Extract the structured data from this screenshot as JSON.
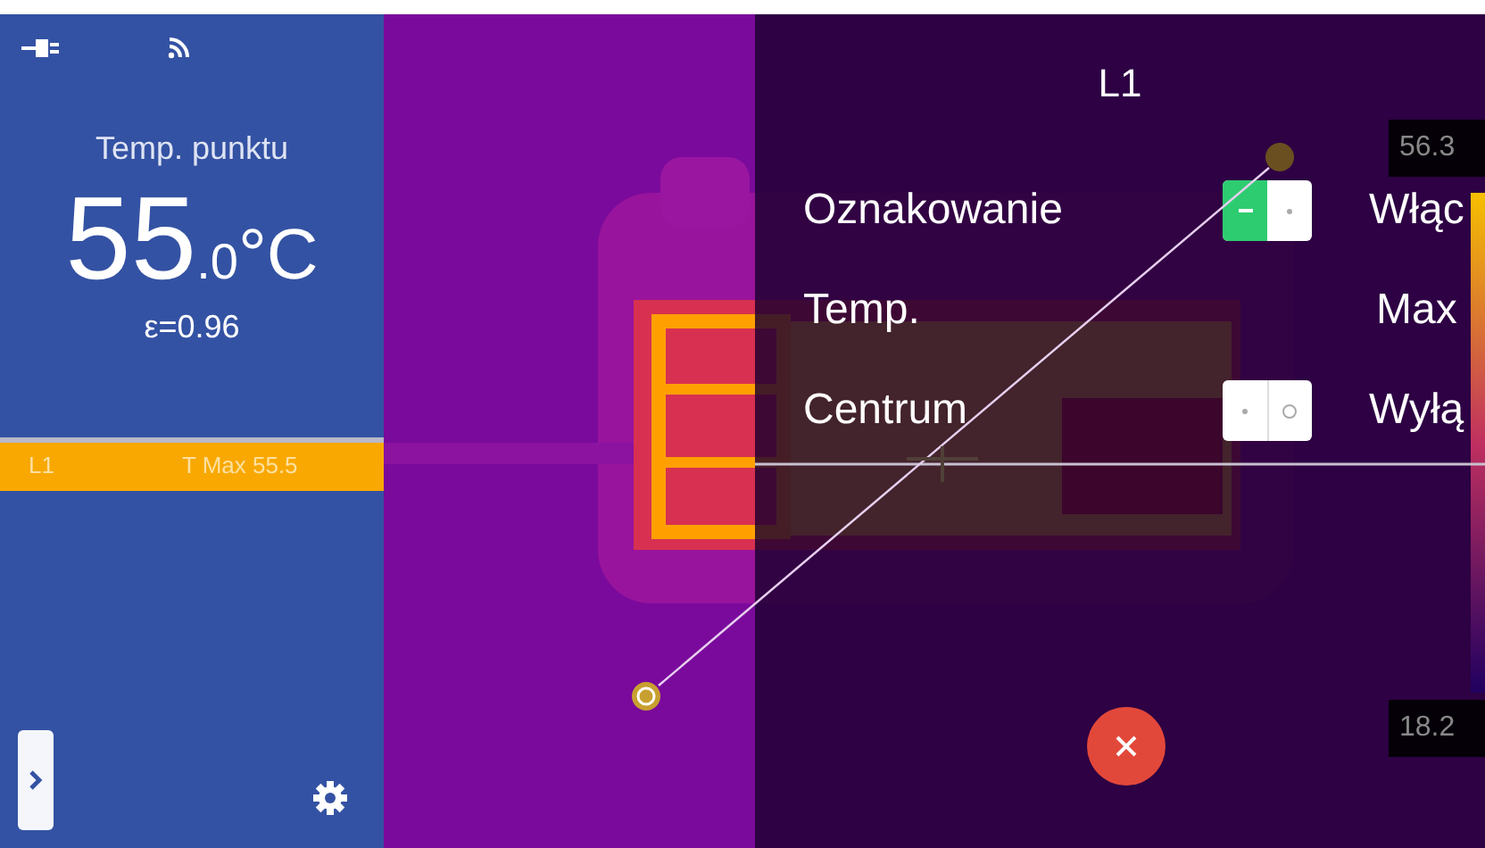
{
  "sidebar": {
    "label": "Temp. punktu",
    "value_main": "55",
    "value_decimal": ".0",
    "unit": "°C",
    "emissivity": "ε=0.96",
    "measurement_bar": {
      "name": "L1",
      "reading": "T Max 55.5"
    }
  },
  "settings_panel": {
    "title": "L1",
    "rows": [
      {
        "kind": "toggle",
        "label": "Oznakowanie",
        "on": true,
        "value": "Włąc"
      },
      {
        "kind": "text",
        "label": "Temp.",
        "value": "Max"
      },
      {
        "kind": "toggle",
        "label": "Centrum",
        "on": false,
        "value": "Wyłą"
      }
    ]
  },
  "scale": {
    "max": "56.3",
    "min": "18.2"
  }
}
